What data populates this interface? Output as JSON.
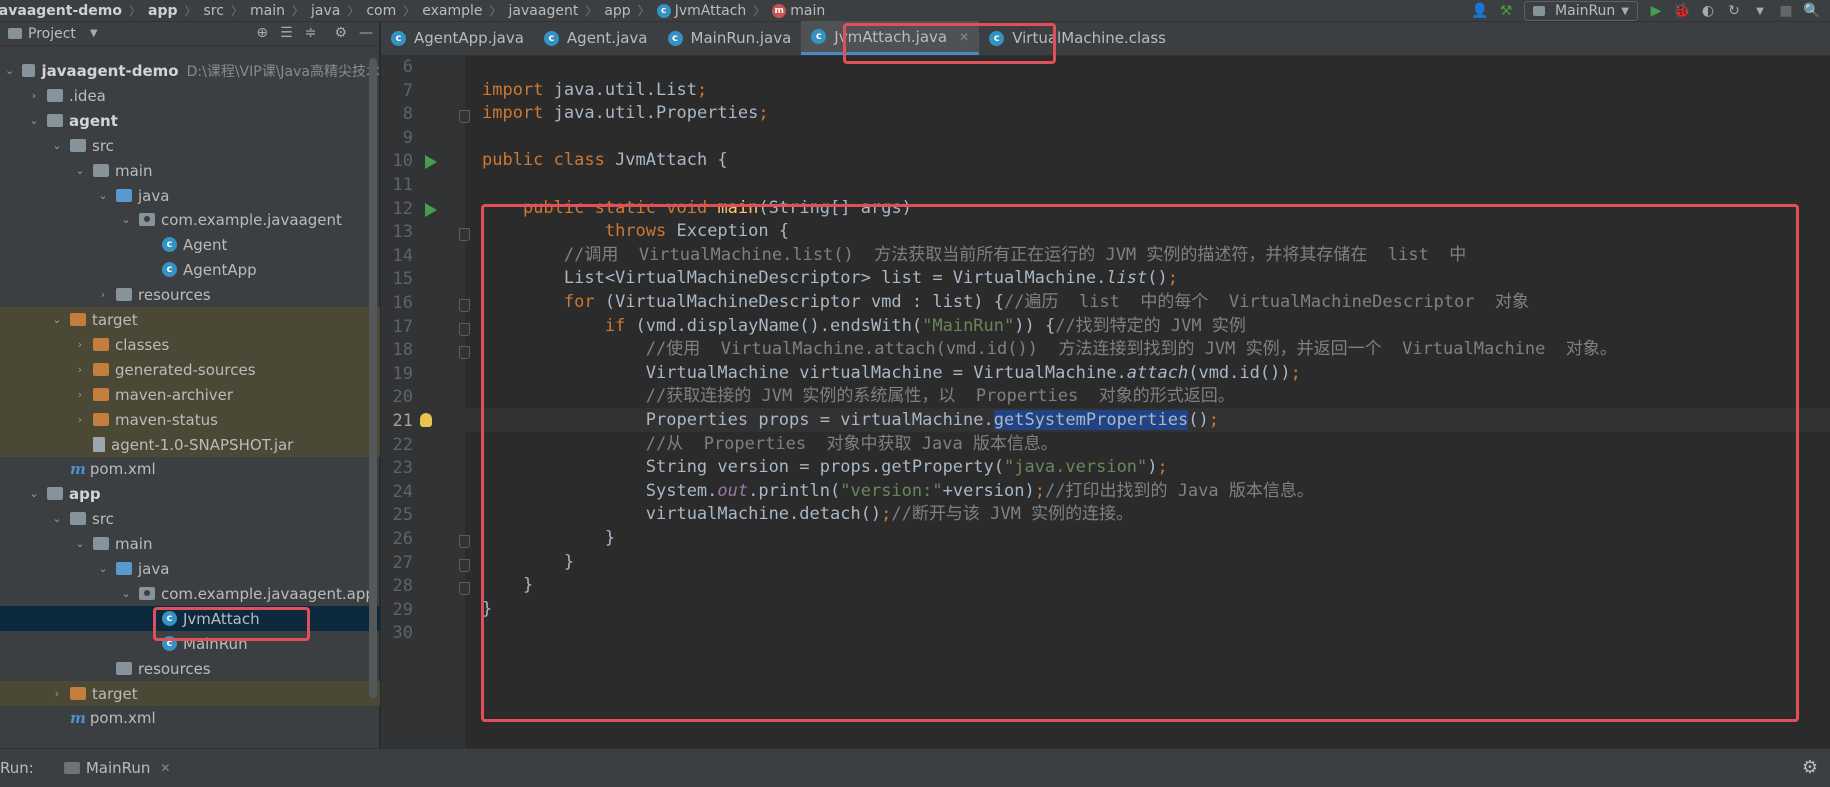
{
  "breadcrumb": {
    "items": [
      "javaagent-demo",
      "app",
      "src",
      "main",
      "java",
      "com",
      "example",
      "javaagent",
      "app",
      "JvmAttach",
      "main"
    ]
  },
  "toolbar": {
    "run_config": "MainRun"
  },
  "project_panel": {
    "title": "Project",
    "tree": [
      {
        "label": "javaagent-demo",
        "hint": "D:\\课程\\VIP课\\Java高精尖技术",
        "depth": 0,
        "icon": "module-folder-icon",
        "expanded": true,
        "bold": true
      },
      {
        "label": ".idea",
        "depth": 1,
        "icon": "folder-icon",
        "expanded": false
      },
      {
        "label": "agent",
        "depth": 1,
        "icon": "module-folder-icon",
        "expanded": true,
        "bold": true
      },
      {
        "label": "src",
        "depth": 2,
        "icon": "folder-icon",
        "expanded": true
      },
      {
        "label": "main",
        "depth": 3,
        "icon": "folder-icon",
        "expanded": true
      },
      {
        "label": "java",
        "depth": 4,
        "icon": "source-folder-icon",
        "expanded": true
      },
      {
        "label": "com.example.javaagent",
        "depth": 5,
        "icon": "package-icon",
        "expanded": true
      },
      {
        "label": "Agent",
        "depth": 6,
        "icon": "class-icon"
      },
      {
        "label": "AgentApp",
        "depth": 6,
        "icon": "class-icon"
      },
      {
        "label": "resources",
        "depth": 4,
        "icon": "resources-folder-icon",
        "expanded": false
      },
      {
        "label": "target",
        "depth": 2,
        "icon": "excluded-folder-icon",
        "expanded": true,
        "excluded": true
      },
      {
        "label": "classes",
        "depth": 3,
        "icon": "excluded-folder-icon",
        "expanded": false,
        "excluded": true
      },
      {
        "label": "generated-sources",
        "depth": 3,
        "icon": "excluded-folder-icon",
        "expanded": false,
        "excluded": true
      },
      {
        "label": "maven-archiver",
        "depth": 3,
        "icon": "excluded-folder-icon",
        "expanded": false,
        "excluded": true
      },
      {
        "label": "maven-status",
        "depth": 3,
        "icon": "excluded-folder-icon",
        "expanded": false,
        "excluded": true
      },
      {
        "label": "agent-1.0-SNAPSHOT.jar",
        "depth": 3,
        "icon": "jar-icon",
        "excluded": true
      },
      {
        "label": "pom.xml",
        "depth": 2,
        "icon": "maven-icon"
      },
      {
        "label": "app",
        "depth": 1,
        "icon": "module-folder-icon",
        "expanded": true,
        "bold": true
      },
      {
        "label": "src",
        "depth": 2,
        "icon": "folder-icon",
        "expanded": true
      },
      {
        "label": "main",
        "depth": 3,
        "icon": "folder-icon",
        "expanded": true
      },
      {
        "label": "java",
        "depth": 4,
        "icon": "source-folder-icon",
        "expanded": true
      },
      {
        "label": "com.example.javaagent.app",
        "depth": 5,
        "icon": "package-icon",
        "expanded": true
      },
      {
        "label": "JvmAttach",
        "depth": 6,
        "icon": "class-icon",
        "selected": true
      },
      {
        "label": "MainRun",
        "depth": 6,
        "icon": "class-icon"
      },
      {
        "label": "resources",
        "depth": 4,
        "icon": "resources-folder-icon"
      },
      {
        "label": "target",
        "depth": 2,
        "icon": "excluded-folder-icon",
        "expanded": false,
        "excluded": true
      },
      {
        "label": "pom.xml",
        "depth": 2,
        "icon": "maven-icon"
      }
    ]
  },
  "tabs": [
    {
      "label": "AgentApp.java",
      "active": false
    },
    {
      "label": "Agent.java",
      "active": false
    },
    {
      "label": "MainRun.java",
      "active": false
    },
    {
      "label": "JvmAttach.java",
      "active": true
    },
    {
      "label": "VirtualMachine.class",
      "active": false
    }
  ],
  "editor": {
    "current_line": 21,
    "lines": [
      {
        "n": "6",
        "html": ""
      },
      {
        "n": "7",
        "html": "<span class=\"kw\">import</span> java.util.List<span class=\"kw\">;</span>"
      },
      {
        "n": "8",
        "html": "<span class=\"kw\">import</span> java.util.Properties<span class=\"kw\">;</span>"
      },
      {
        "n": "9",
        "html": ""
      },
      {
        "n": "10",
        "html": "<span class=\"kw\">public class</span> JvmAttach {"
      },
      {
        "n": "11",
        "html": ""
      },
      {
        "n": "12",
        "html": "    <span class=\"kw\">public static void</span> <span class=\"fn\">main</span>(String[] args)"
      },
      {
        "n": "13",
        "html": "            <span class=\"kw\">throws</span> Exception {"
      },
      {
        "n": "14",
        "html": "        <span class=\"com\">//调用  VirtualMachine.list()  方法获取当前所有正在运行的 JVM 实例的描述符，并将其存储在  list  中</span>"
      },
      {
        "n": "15",
        "html": "        List&lt;VirtualMachineDescriptor&gt; list = VirtualMachine.<span class=\"it\">list</span>()<span class=\"kw\">;</span>"
      },
      {
        "n": "16",
        "html": "        <span class=\"kw\">for</span> (VirtualMachineDescriptor vmd : list) {<span class=\"com\">//遍历  list  中的每个  VirtualMachineDescriptor  对象</span>"
      },
      {
        "n": "17",
        "html": "            <span class=\"kw\">if</span> (vmd.displayName().endsWith(<span class=\"str\">\"MainRun\"</span>)) {<span class=\"com\">//找到特定的 JVM 实例</span>"
      },
      {
        "n": "18",
        "html": "                <span class=\"com\">//使用  VirtualMachine.attach(vmd.id())  方法连接到找到的 JVM 实例，并返回一个  VirtualMachine  对象。</span>"
      },
      {
        "n": "19",
        "html": "                VirtualMachine virtualMachine = VirtualMachine.<span class=\"it\">attach</span>(vmd.id())<span class=\"kw\">;</span>"
      },
      {
        "n": "20",
        "html": "                <span class=\"com\">//获取连接的 JVM 实例的系统属性，以  Properties  对象的形式返回。</span>"
      },
      {
        "n": "21",
        "html": "                Properties props = virtualMachine.<span class=\"hl\">getSystemProperties</span>()<span class=\"kw\">;</span>"
      },
      {
        "n": "22",
        "html": "                <span class=\"com\">//从  Properties  对象中获取 Java 版本信息。</span>"
      },
      {
        "n": "23",
        "html": "                String version = props.getProperty(<span class=\"str\">\"java.version\"</span>)<span class=\"kw\">;</span>"
      },
      {
        "n": "24",
        "html": "                System.<span class=\"sf\">out</span>.println(<span class=\"str\">\"version:\"</span>+version)<span class=\"kw\">;</span><span class=\"com\">//打印出找到的 Java 版本信息。</span>"
      },
      {
        "n": "25",
        "html": "                virtualMachine.detach()<span class=\"kw\">;</span><span class=\"com\">//断开与该 JVM 实例的连接。</span>"
      },
      {
        "n": "26",
        "html": "            }"
      },
      {
        "n": "27",
        "html": "        }"
      },
      {
        "n": "28",
        "html": "    }"
      },
      {
        "n": "29",
        "html": "}"
      },
      {
        "n": "30",
        "html": ""
      }
    ]
  },
  "runbar": {
    "label": "Run:",
    "tab": "MainRun"
  },
  "colors": {
    "highlight_box": "#e0505a",
    "keyword": "#cc7832",
    "string": "#6a8759",
    "comment": "#808080"
  }
}
